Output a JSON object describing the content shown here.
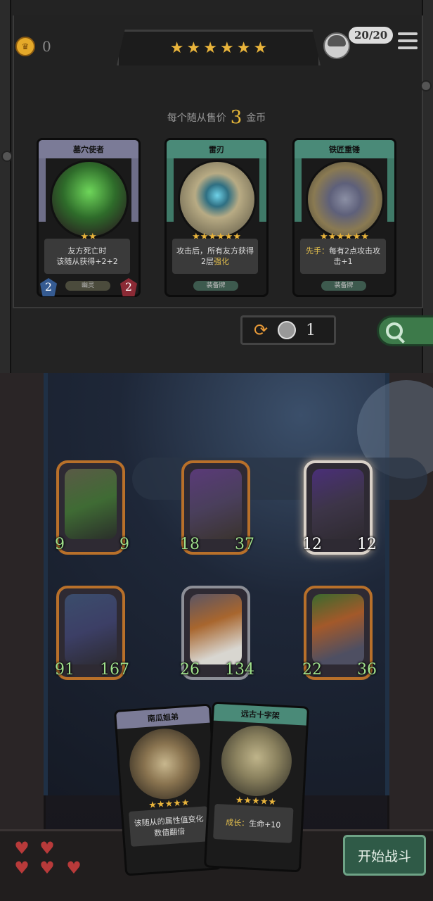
{
  "header": {
    "gold": "0",
    "level_stars": 6,
    "population": "20/20"
  },
  "shop": {
    "price_prefix": "每个随从售价",
    "price_value": "3",
    "price_suffix": "金币",
    "cards": [
      {
        "name": "墓穴使者",
        "stars": 2,
        "desc": "友方死亡时\n该随从获得+2+2",
        "tag": "幽灵",
        "atk": "2",
        "hp": "2",
        "theme": "purple"
      },
      {
        "name": "雷刃",
        "stars": 6,
        "desc_a": "攻击后，所有友方获得2层",
        "desc_hl": "强化",
        "tag": "装备牌",
        "theme": "green"
      },
      {
        "name": "铁匠重锤",
        "stars": 6,
        "desc_hl": "先手：",
        "desc_a": "每有2点攻击攻击+1",
        "tag": "装备牌",
        "theme": "green"
      }
    ],
    "refresh_cost": "1"
  },
  "board": {
    "units": [
      {
        "atk": "9",
        "hp": "9"
      },
      {
        "atk": "18",
        "hp": "37"
      },
      {
        "atk": "12",
        "hp": "12"
      },
      {
        "atk": "91",
        "hp": "167"
      },
      {
        "atk": "26",
        "hp": "134"
      },
      {
        "atk": "22",
        "hp": "36"
      }
    ]
  },
  "hand": [
    {
      "name": "南瓜姐弟",
      "stars": 5,
      "desc": "该随从的属性值变化数值翻倍",
      "theme": "purple"
    },
    {
      "name": "远古十字架",
      "stars": 5,
      "desc_hl": "成长：",
      "desc_a": "生命+10",
      "theme": "green"
    }
  ],
  "lives": 5,
  "start_button": "开始战斗",
  "colors": {
    "gold": "#e9b43b",
    "accent_green": "#3d7a4a",
    "unit_frame": "#b8702a"
  }
}
